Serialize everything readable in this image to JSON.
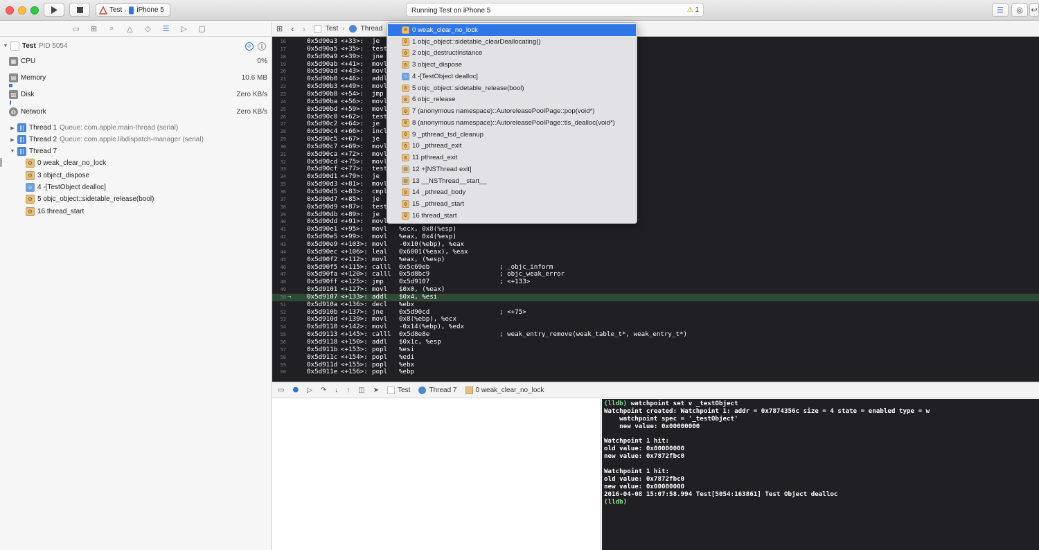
{
  "toolbar": {
    "scheme_target": "Test",
    "scheme_device": "iPhone 5",
    "status_text": "Running Test on iPhone 5",
    "warning_count": "1"
  },
  "navigator": {
    "process": {
      "name": "Test",
      "pid": "PID 5054"
    },
    "gauges": [
      {
        "label": "CPU",
        "value": "0%"
      },
      {
        "label": "Memory",
        "value": "10.6 MB"
      },
      {
        "label": "Disk",
        "value": "Zero KB/s"
      },
      {
        "label": "Network",
        "value": "Zero KB/s"
      }
    ],
    "threads": [
      {
        "name": "Thread 1",
        "queue": "Queue: com.apple.main-thread (serial)"
      },
      {
        "name": "Thread 2",
        "queue": "Queue: com.apple.libdispatch-manager (serial)"
      },
      {
        "name": "Thread 7",
        "queue": ""
      }
    ],
    "frames": [
      "0 weak_clear_no_lock",
      "3 object_dispose",
      "4 -[TestObject dealloc]",
      "5 objc_object::sidetable_release(bool)",
      "16 thread_start"
    ]
  },
  "jumpbar": {
    "item1": "Test",
    "item2": "Thread"
  },
  "popup_items": [
    "0 weak_clear_no_lock",
    "1 objc_object::sidetable_clearDeallocating()",
    "2 objc_destructInstance",
    "3 object_dispose",
    "4 -[TestObject dealloc]",
    "5 objc_object::sidetable_release(bool)",
    "6 objc_release",
    "7 (anonymous namespace)::AutoreleasePoolPage::pop(void*)",
    "8 (anonymous namespace)::AutoreleasePoolPage::tls_dealloc(void*)",
    "9 _pthread_tsd_cleanup",
    "10 _pthread_exit",
    "11 pthread_exit",
    "12 +[NSThread exit]",
    "13 __NSThread__start__",
    "14 _pthread_body",
    "15 _pthread_start",
    "16 thread_start"
  ],
  "code_lines": [
    {
      "ln": "16",
      "addr": "0x5d90a3",
      "off": "<+33>:",
      "op": "je",
      "arg": "",
      "cmt": ""
    },
    {
      "ln": "17",
      "addr": "0x5d90a5",
      "off": "<+35>:",
      "op": "test",
      "arg": "",
      "cmt": ""
    },
    {
      "ln": "18",
      "addr": "0x5d90a9",
      "off": "<+39>:",
      "op": "jne",
      "arg": "",
      "cmt": ""
    },
    {
      "ln": "19",
      "addr": "0x5d90ab",
      "off": "<+41>:",
      "op": "movl",
      "arg": "",
      "cmt": ""
    },
    {
      "ln": "20",
      "addr": "0x5d90ad",
      "off": "<+43>:",
      "op": "movl",
      "arg": "",
      "cmt": ""
    },
    {
      "ln": "21",
      "addr": "0x5d90b0",
      "off": "<+46>:",
      "op": "addl",
      "arg": "",
      "cmt": ""
    },
    {
      "ln": "22",
      "addr": "0x5d90b3",
      "off": "<+49>:",
      "op": "movl",
      "arg": "",
      "cmt": ""
    },
    {
      "ln": "23",
      "addr": "0x5d90b8",
      "off": "<+54>:",
      "op": "jmp",
      "arg": "",
      "cmt": ""
    },
    {
      "ln": "24",
      "addr": "0x5d90ba",
      "off": "<+56>:",
      "op": "movl",
      "arg": "",
      "cmt": ""
    },
    {
      "ln": "25",
      "addr": "0x5d90bd",
      "off": "<+59>:",
      "op": "movl",
      "arg": "",
      "cmt": ""
    },
    {
      "ln": "26",
      "addr": "0x5d90c0",
      "off": "<+62>:",
      "op": "test",
      "arg": "",
      "cmt": ""
    },
    {
      "ln": "27",
      "addr": "0x5d90c2",
      "off": "<+64>:",
      "op": "je",
      "arg": "",
      "cmt": ""
    },
    {
      "ln": "28",
      "addr": "0x5d90c4",
      "off": "<+66>:",
      "op": "incl",
      "arg": "",
      "cmt": ""
    },
    {
      "ln": "29",
      "addr": "0x5d90c5",
      "off": "<+67>:",
      "op": "je",
      "arg": "",
      "cmt": ""
    },
    {
      "ln": "30",
      "addr": "0x5d90c7",
      "off": "<+69>:",
      "op": "movl",
      "arg": "",
      "cmt": ""
    },
    {
      "ln": "31",
      "addr": "0x5d90ca",
      "off": "<+72>:",
      "op": "movl",
      "arg": "",
      "cmt": ""
    },
    {
      "ln": "32",
      "addr": "0x5d90cd",
      "off": "<+75>:",
      "op": "movl",
      "arg": "",
      "cmt": ""
    },
    {
      "ln": "33",
      "addr": "0x5d90cf",
      "off": "<+77>:",
      "op": "test",
      "arg": "",
      "cmt": ""
    },
    {
      "ln": "34",
      "addr": "0x5d90d1",
      "off": "<+79>:",
      "op": "je",
      "arg": "",
      "cmt": ""
    },
    {
      "ln": "35",
      "addr": "0x5d90d3",
      "off": "<+81>:",
      "op": "movl",
      "arg": "",
      "cmt": ""
    },
    {
      "ln": "36",
      "addr": "0x5d90d5",
      "off": "<+83>:",
      "op": "cmpl",
      "arg": "",
      "cmt": ""
    },
    {
      "ln": "37",
      "addr": "0x5d90d7",
      "off": "<+85>:",
      "op": "je",
      "arg": "",
      "cmt": ""
    },
    {
      "ln": "38",
      "addr": "0x5d90d9",
      "off": "<+87>:",
      "op": "test",
      "arg": "",
      "cmt": ""
    },
    {
      "ln": "39",
      "addr": "0x5d90db",
      "off": "<+89>:",
      "op": "je",
      "arg": "",
      "cmt": ""
    },
    {
      "ln": "40",
      "addr": "0x5d90dd",
      "off": "<+91>:",
      "op": "movl",
      "arg": "",
      "cmt": ""
    },
    {
      "ln": "41",
      "addr": "0x5d90e1",
      "off": "<+95>:",
      "op": "movl",
      "arg": "%ecx, 0x8(%esp)",
      "cmt": ""
    },
    {
      "ln": "42",
      "addr": "0x5d90e5",
      "off": "<+99>:",
      "op": "movl",
      "arg": "%eax, 0x4(%esp)",
      "cmt": ""
    },
    {
      "ln": "43",
      "addr": "0x5d90e9",
      "off": "<+103>:",
      "op": "movl",
      "arg": "-0x10(%ebp), %eax",
      "cmt": ""
    },
    {
      "ln": "44",
      "addr": "0x5d90ec",
      "off": "<+106>:",
      "op": "leal",
      "arg": "0x6001(%eax), %eax",
      "cmt": ""
    },
    {
      "ln": "45",
      "addr": "0x5d90f2",
      "off": "<+112>:",
      "op": "movl",
      "arg": "%eax, (%esp)",
      "cmt": ""
    },
    {
      "ln": "46",
      "addr": "0x5d90f5",
      "off": "<+115>:",
      "op": "calll",
      "arg": "0x5c69eb",
      "cmt": "; _objc_inform"
    },
    {
      "ln": "47",
      "addr": "0x5d90fa",
      "off": "<+120>:",
      "op": "calll",
      "arg": "0x5d8bc9",
      "cmt": "; objc_weak_error"
    },
    {
      "ln": "48",
      "addr": "0x5d90ff",
      "off": "<+125>:",
      "op": "jmp",
      "arg": "0x5d9107",
      "cmt": "; <+133>"
    },
    {
      "ln": "49",
      "addr": "0x5d9101",
      "off": "<+127>:",
      "op": "movl",
      "arg": "$0x0, (%eax)",
      "cmt": ""
    },
    {
      "ln": "50",
      "addr": "0x5d9107",
      "off": "<+133>:",
      "op": "addl",
      "arg": "$0x4, %esi",
      "cmt": "",
      "current": true
    },
    {
      "ln": "51",
      "addr": "0x5d910a",
      "off": "<+136>:",
      "op": "decl",
      "arg": "%ebx",
      "cmt": ""
    },
    {
      "ln": "52",
      "addr": "0x5d910b",
      "off": "<+137>:",
      "op": "jne",
      "arg": "0x5d90cd",
      "cmt": "; <+75>"
    },
    {
      "ln": "53",
      "addr": "0x5d910d",
      "off": "<+139>:",
      "op": "movl",
      "arg": "0x8(%ebp), %ecx",
      "cmt": ""
    },
    {
      "ln": "54",
      "addr": "0x5d9110",
      "off": "<+142>:",
      "op": "movl",
      "arg": "-0x14(%ebp), %edx",
      "cmt": ""
    },
    {
      "ln": "55",
      "addr": "0x5d9113",
      "off": "<+145>:",
      "op": "calll",
      "arg": "0x5d8e8e",
      "cmt": "; weak_entry_remove(weak_table_t*, weak_entry_t*)"
    },
    {
      "ln": "56",
      "addr": "0x5d9118",
      "off": "<+150>:",
      "op": "addl",
      "arg": "$0x1c, %esp",
      "cmt": ""
    },
    {
      "ln": "57",
      "addr": "0x5d911b",
      "off": "<+153>:",
      "op": "popl",
      "arg": "%esi",
      "cmt": ""
    },
    {
      "ln": "58",
      "addr": "0x5d911c",
      "off": "<+154>:",
      "op": "popl",
      "arg": "%edi",
      "cmt": ""
    },
    {
      "ln": "59",
      "addr": "0x5d911d",
      "off": "<+155>:",
      "op": "popl",
      "arg": "%ebx",
      "cmt": ""
    },
    {
      "ln": "60",
      "addr": "0x5d911e",
      "off": "<+156>:",
      "op": "popl",
      "arg": "%ebp",
      "cmt": ""
    }
  ],
  "current_arrow": "→",
  "debugbar": {
    "item1": "Test",
    "item2": "Thread 7",
    "item3": "0 weak_clear_no_lock"
  },
  "console_lines": [
    {
      "text": "(lldb) watchpoint set v _testObject",
      "style": "cmd"
    },
    {
      "text": "Watchpoint created: Watchpoint 1: addr = 0x7874356c size = 4 state = enabled type = w",
      "style": "bold"
    },
    {
      "text": "    watchpoint spec = '_testObject'",
      "style": "bold"
    },
    {
      "text": "    new value: 0x00000000",
      "style": "bold"
    },
    {
      "text": "",
      "style": "bold"
    },
    {
      "text": "Watchpoint 1 hit:",
      "style": "bold"
    },
    {
      "text": "old value: 0x00000000",
      "style": "bold"
    },
    {
      "text": "new value: 0x7872fbc0",
      "style": "bold"
    },
    {
      "text": "",
      "style": "bold"
    },
    {
      "text": "Watchpoint 1 hit:",
      "style": "bold"
    },
    {
      "text": "old value: 0x7872fbc0",
      "style": "bold"
    },
    {
      "text": "new value: 0x00000000",
      "style": "bold"
    },
    {
      "text": "2016-04-08 15:07:58.994 Test[5054:163861] Test Object dealloc",
      "style": "bold"
    },
    {
      "text": "(lldb)",
      "style": "prompt"
    }
  ]
}
